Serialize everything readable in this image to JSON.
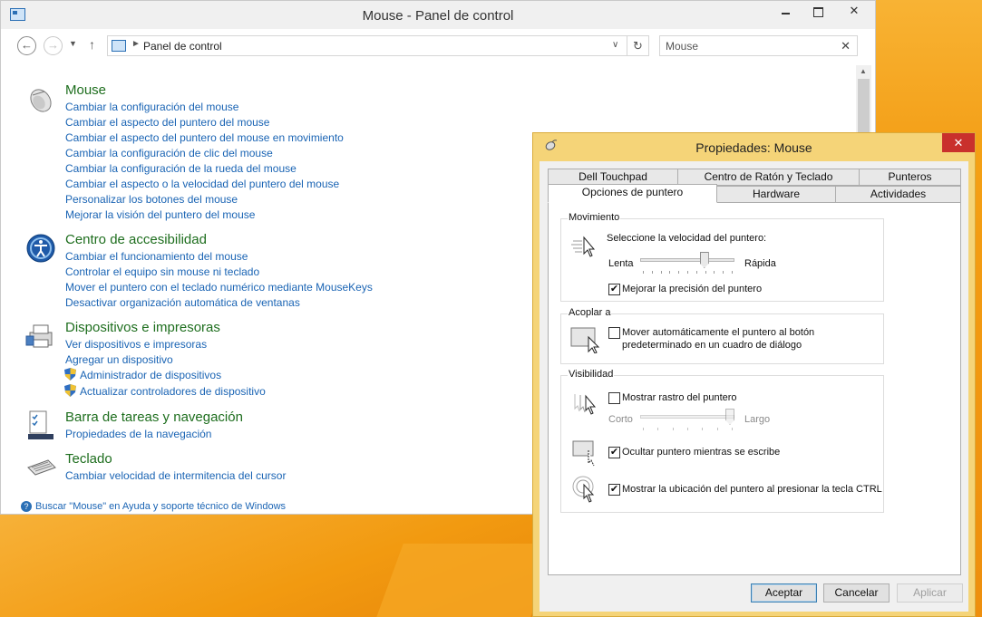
{
  "control_panel": {
    "title": "Mouse - Panel de control",
    "address": "Panel de control",
    "search_value": "Mouse",
    "categories": [
      {
        "title": "Mouse",
        "links": [
          "Cambiar la configuración del mouse",
          "Cambiar el aspecto del puntero del mouse",
          "Cambiar el aspecto del puntero del mouse en movimiento",
          "Cambiar la configuración de clic del mouse",
          "Cambiar la configuración de la rueda del mouse",
          "Cambiar el aspecto o la velocidad del puntero del mouse",
          "Personalizar los botones del mouse",
          "Mejorar la visión del puntero del mouse"
        ]
      },
      {
        "title": "Centro de accesibilidad",
        "links": [
          "Cambiar el funcionamiento del mouse",
          "Controlar el equipo sin mouse ni teclado",
          "Mover el puntero con el teclado numérico mediante MouseKeys",
          "Desactivar organización automática de ventanas"
        ]
      },
      {
        "title": "Dispositivos e impresoras",
        "links": [
          "Ver dispositivos e impresoras",
          "Agregar un dispositivo",
          "Administrador de dispositivos",
          "Actualizar controladores de dispositivo"
        ]
      },
      {
        "title": "Barra de tareas y navegación",
        "links": [
          "Propiedades de la navegación"
        ]
      },
      {
        "title": "Teclado",
        "links": [
          "Cambiar velocidad de intermitencia del cursor"
        ]
      }
    ],
    "footer_link": "Buscar \"Mouse\" en Ayuda y soporte técnico de Windows"
  },
  "dialog": {
    "title": "Propiedades: Mouse",
    "close_glyph": "✕",
    "tabs_row1": [
      "Dell Touchpad",
      "Centro de Ratón y Teclado",
      "Punteros"
    ],
    "tabs_row2": [
      "Opciones de puntero",
      "Hardware",
      "Actividades"
    ],
    "active_tab": "Opciones de puntero",
    "movimiento": {
      "label": "Movimiento",
      "prompt": "Seleccione la velocidad del puntero:",
      "slow": "Lenta",
      "fast": "Rápida",
      "speed_level": 0.7,
      "precision_label": "Mejorar la precisión del puntero",
      "precision_checked": true
    },
    "acoplar": {
      "label": "Acoplar a",
      "option_line1": "Mover automáticamente el puntero al botón",
      "option_line2": "predeterminado en un cuadro de diálogo",
      "checked": false
    },
    "visibilidad": {
      "label": "Visibilidad",
      "trail_label": "Mostrar rastro del puntero",
      "trail_checked": false,
      "short": "Corto",
      "long": "Largo",
      "trail_level": 1.0,
      "hide_label": "Ocultar puntero mientras se escribe",
      "hide_checked": true,
      "ctrl_label": "Mostrar la ubicación del puntero al presionar la tecla CTRL",
      "ctrl_checked": true
    },
    "buttons": {
      "ok": "Aceptar",
      "cancel": "Cancelar",
      "apply": "Aplicar"
    }
  },
  "colors": {
    "link": "#1a64b4",
    "category_title": "#1e6e1e",
    "dialog_frame": "#f5d478",
    "close_red": "#c9302c",
    "desktop": "#f39c12"
  }
}
